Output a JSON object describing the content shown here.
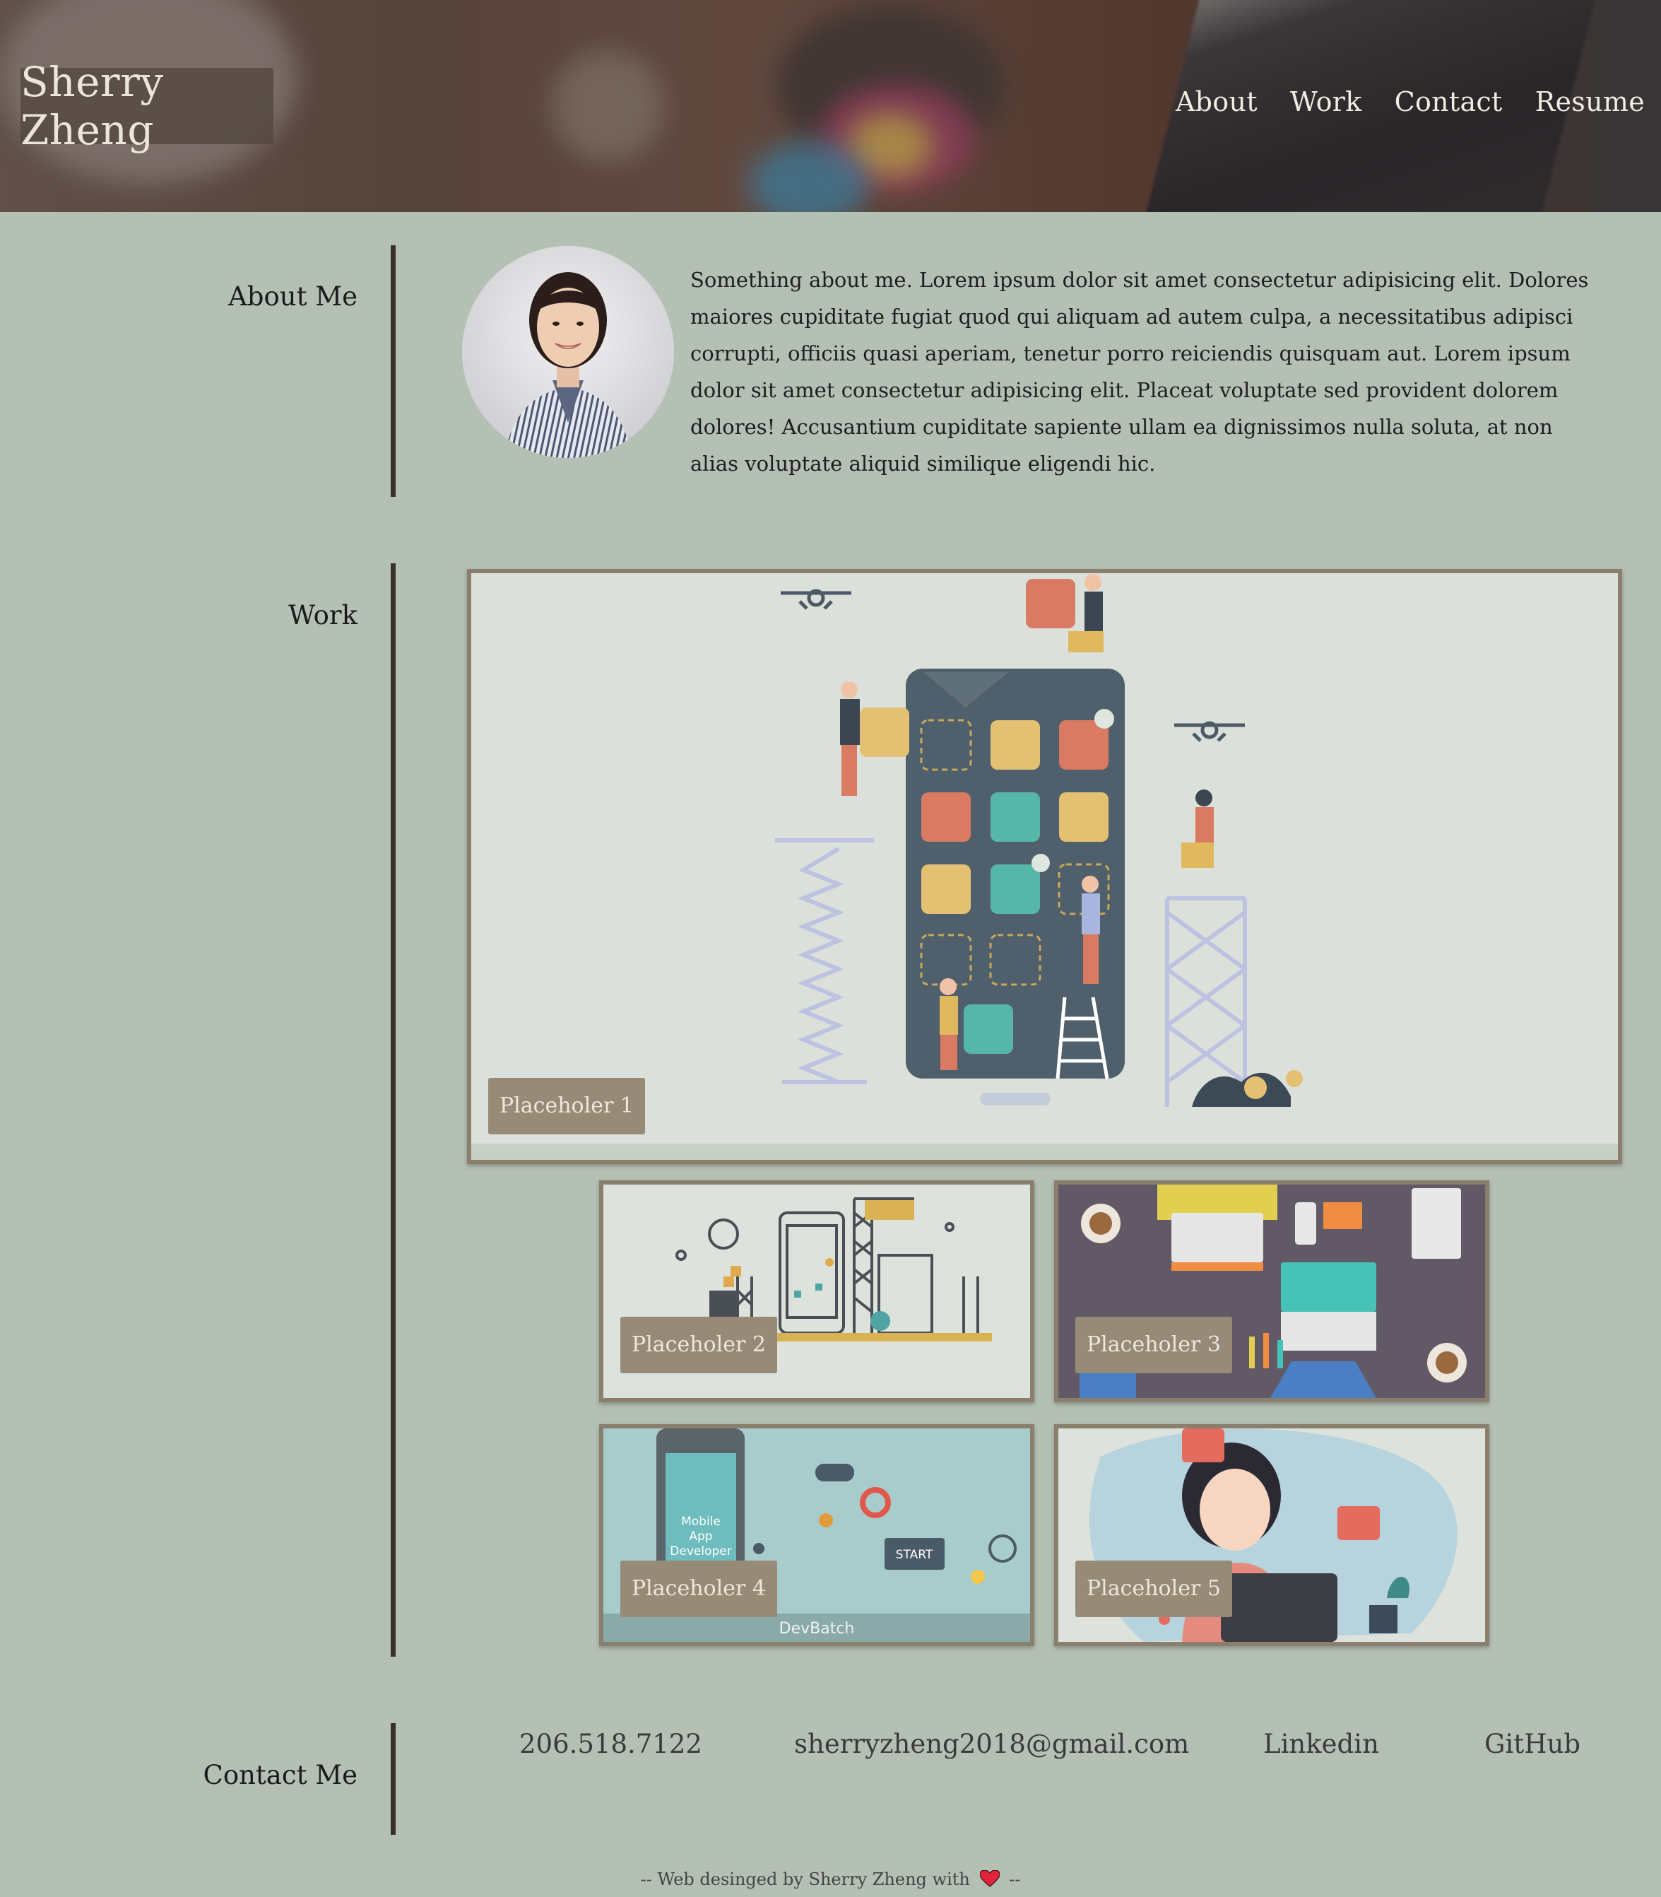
{
  "header": {
    "brand": "Sherry Zheng",
    "nav": [
      "About",
      "Work",
      "Contact",
      "Resume"
    ]
  },
  "about": {
    "title": "About Me",
    "text": "Something about me. Lorem ipsum dolor sit amet consectetur adipisicing elit. Dolores maiores cupiditate fugiat quod qui aliquam ad autem culpa, a necessitatibus adipisci corrupti, officiis quasi aperiam, tenetur porro reiciendis quisquam aut. Lorem ipsum dolor sit amet consectetur adipisicing elit. Placeat voluptate sed provident dolorem dolores! Accusantium cupiditate sapiente ullam ea dignissimos nulla soluta, at non alias voluptate aliquid similique eligendi hic."
  },
  "work": {
    "title": "Work",
    "projects": [
      {
        "label": "Placeholer 1"
      },
      {
        "label": "Placeholer 2"
      },
      {
        "label": "Placeholer 3"
      },
      {
        "label": "Placeholer 4",
        "image_text": [
          "Mobile",
          "App",
          "Developer",
          "START",
          "DevBatch"
        ]
      },
      {
        "label": "Placeholer 5"
      }
    ]
  },
  "contact": {
    "title": "Contact Me",
    "phone": "206.518.7122",
    "email": "sherryzheng2018@gmail.com",
    "linkedin": "Linkedin",
    "github": "GitHub"
  },
  "footer": {
    "prefix": "-- Web desinged by Sherry Zheng with",
    "suffix": "--"
  },
  "colors": {
    "page_bg": "#b5c0b4",
    "accent_bar": "#3a2f2d",
    "card_border": "#8a7e6c",
    "label_bg": "#978b78"
  }
}
